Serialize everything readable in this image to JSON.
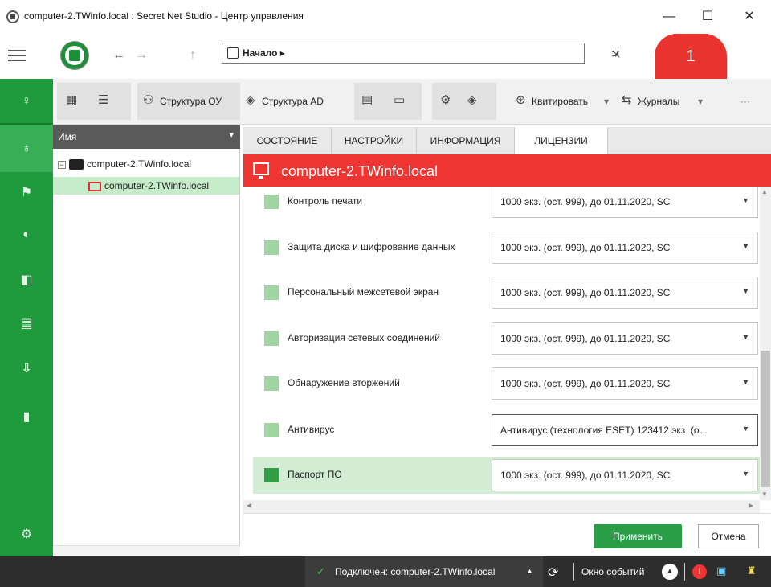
{
  "window": {
    "title": "computer-2.TWinfo.local : Secret Net Studio - Центр управления",
    "minimize": "—",
    "maximize": "☐",
    "close": "✕"
  },
  "nav": {
    "back": "←",
    "forward": "→",
    "up": "↑",
    "breadcrumb": "Начало ▸",
    "notification_count": "1"
  },
  "toolbar": {
    "structure_ou": "Структура ОУ",
    "structure_ad": "Структура AD",
    "acknowledge": "Квитировать",
    "journals": "Журналы",
    "more": "···",
    "dropdown": "▾"
  },
  "tree": {
    "header": "Имя",
    "nodes": [
      {
        "label": "computer-2.TWinfo.local"
      },
      {
        "label": "computer-2.TWinfo.local"
      }
    ]
  },
  "tabs": [
    {
      "label": "СОСТОЯНИЕ"
    },
    {
      "label": "НАСТРОЙКИ"
    },
    {
      "label": "ИНФОРМАЦИЯ"
    },
    {
      "label": "ЛИЦЕНЗИИ"
    }
  ],
  "header": {
    "computer_name": "computer-2.TWinfo.local"
  },
  "licenses": [
    {
      "name": "Контроль печати",
      "value": "1000 экз. (ост. 999), до 01.11.2020, SC"
    },
    {
      "name": "Защита диска и шифрование данных",
      "value": "1000 экз. (ост. 999), до 01.11.2020, SC"
    },
    {
      "name": "Персональный межсетевой экран",
      "value": "1000 экз. (ост. 999), до 01.11.2020, SC"
    },
    {
      "name": "Авторизация сетевых соединений",
      "value": "1000 экз. (ост. 999), до 01.11.2020, SC"
    },
    {
      "name": "Обнаружение вторжений",
      "value": "1000 экз. (ост. 999), до 01.11.2020, SC"
    },
    {
      "name": "Антивирус",
      "value": "Антивирус (технология ESET) 123412 экз. (о..."
    },
    {
      "name": "Паспорт ПО",
      "value": "1000 экз. (ост. 999), до 01.11.2020, SC"
    }
  ],
  "buttons": {
    "apply": "Применить",
    "cancel": "Отмена"
  },
  "status": {
    "connection": "Подключен: computer-2.TWinfo.local",
    "events": "Окно событий"
  },
  "colors": {
    "accent_green": "#1f9a3d",
    "header_red": "#ee3531",
    "badge_red": "#e8332f"
  }
}
